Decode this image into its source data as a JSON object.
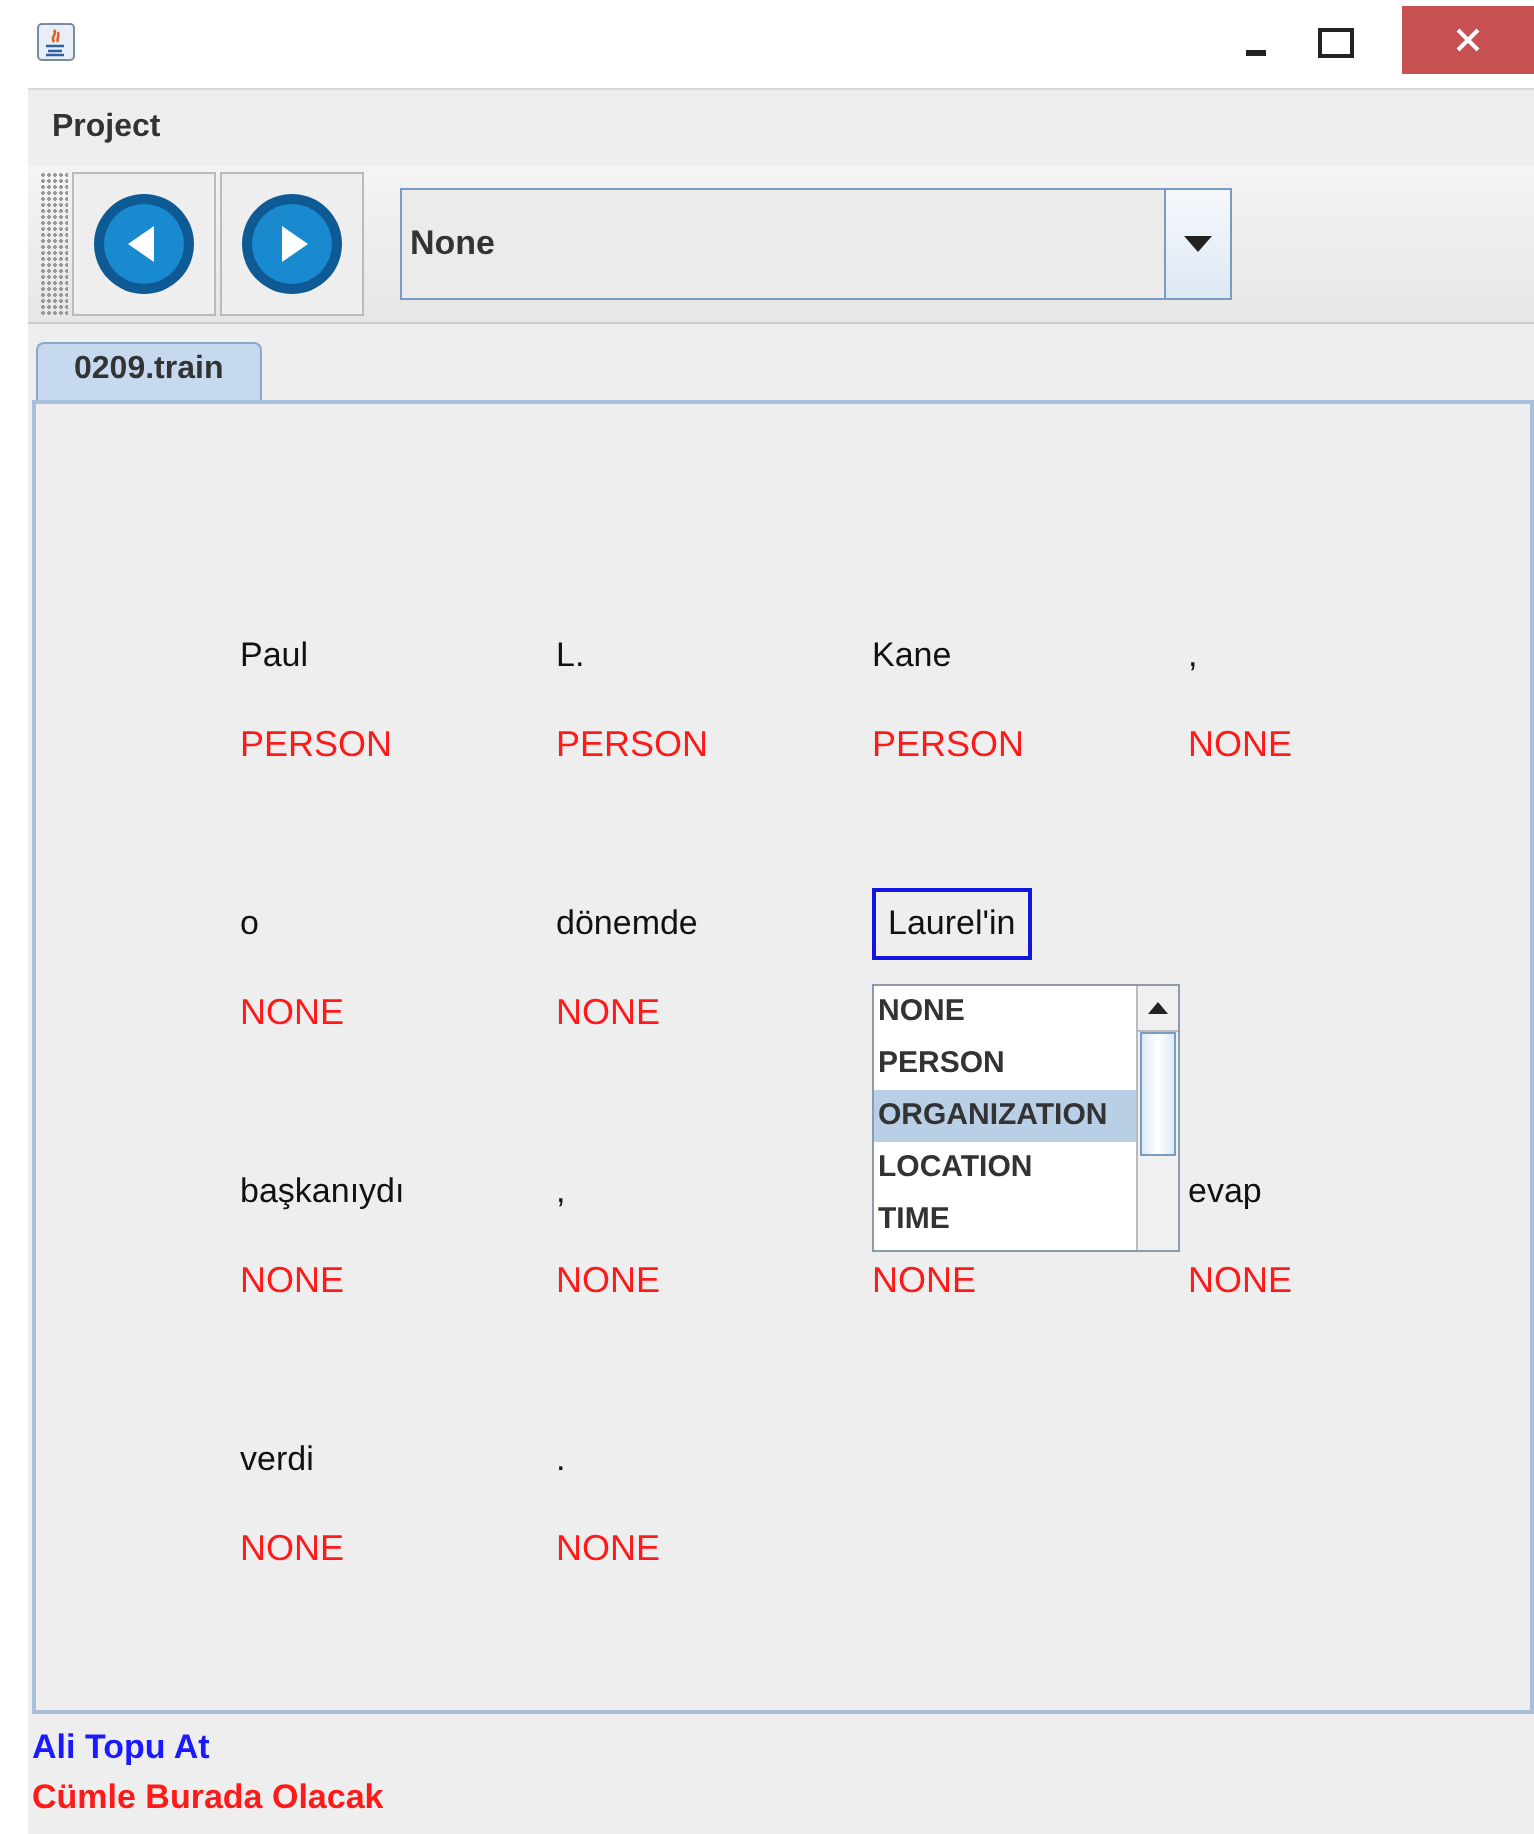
{
  "menu": [
    "Project"
  ],
  "toolbar": {
    "combo": {
      "value": "None"
    }
  },
  "tabs": [
    {
      "label": "0209.train",
      "selected": true
    }
  ],
  "rows": [
    {
      "tokens": [
        {
          "word": "Paul",
          "label": "PERSON"
        },
        {
          "word": "L.",
          "label": "PERSON"
        },
        {
          "word": "Kane",
          "label": "PERSON"
        },
        {
          "word": ",",
          "label": "NONE"
        }
      ]
    },
    {
      "tokens": [
        {
          "word": "o",
          "label": "NONE"
        },
        {
          "word": "dönemde",
          "label": "NONE"
        },
        {
          "word": "Laurel'in",
          "focused": true,
          "list": [
            {
              "label": "NONE",
              "selected": false
            },
            {
              "label": "PERSON",
              "selected": false
            },
            {
              "label": "ORGANIZATION",
              "selected": true
            },
            {
              "label": "LOCATION",
              "selected": false
            },
            {
              "label": "TIME",
              "selected": false
            }
          ]
        }
      ]
    },
    {
      "tokens": [
        {
          "word": "başkanıydı",
          "label": "NONE"
        },
        {
          "word": ",",
          "label": "NONE"
        },
        {
          "label": "NONE"
        },
        {
          "word": "evap",
          "label": "NONE"
        }
      ]
    },
    {
      "tokens": [
        {
          "word": "verdi",
          "label": "NONE"
        },
        {
          "word": ".",
          "label": "NONE"
        }
      ]
    }
  ],
  "status": [
    {
      "text": "Ali Topu At",
      "color": "#1a1aff"
    },
    {
      "text": "Cümle Burada Olacak",
      "color": "#ff1a1a"
    }
  ]
}
